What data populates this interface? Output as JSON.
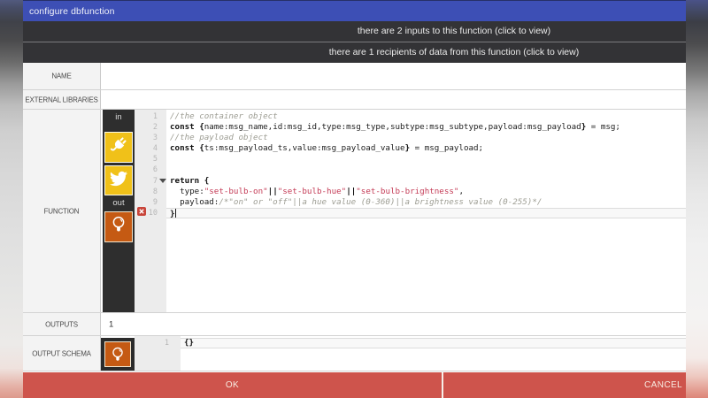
{
  "dialog": {
    "title": "configure dbfunction"
  },
  "info_bars": [
    {
      "label": "there are 2 inputs to this function (click to view)"
    },
    {
      "label": "there are 1 recipients of data from this function (click to view)"
    }
  ],
  "rows": {
    "name": {
      "label": "NAME",
      "value": ""
    },
    "external_libraries": {
      "label": "EXTERNAL LIBRARIES",
      "value": ""
    },
    "function": {
      "label": "FUNCTION"
    },
    "outputs": {
      "label": "OUTPUTS",
      "value": "1"
    },
    "output_schema": {
      "label": "OUTPUT SCHEMA"
    }
  },
  "function_editor": {
    "in_label": "in",
    "out_label": "out",
    "icons": [
      "plug-icon",
      "twitter-icon",
      "bulb-icon"
    ],
    "lines": [
      {
        "num": 1,
        "seg": [
          [
            "cm",
            "//the container object"
          ]
        ]
      },
      {
        "num": 2,
        "seg": [
          [
            "kw",
            "const"
          ],
          [
            "pl",
            " "
          ],
          [
            "br",
            "{"
          ],
          [
            "pl",
            "name:msg_name,id:msg_id,type:msg_type,subtype:msg_subtype,payload:msg_payload"
          ],
          [
            "br",
            "}"
          ],
          [
            "pl",
            " = msg;"
          ]
        ]
      },
      {
        "num": 3,
        "seg": [
          [
            "cm",
            "//the payload object"
          ]
        ]
      },
      {
        "num": 4,
        "seg": [
          [
            "kw",
            "const"
          ],
          [
            "pl",
            " "
          ],
          [
            "br",
            "{"
          ],
          [
            "pl",
            "ts:msg_payload_ts,value:msg_payload_value"
          ],
          [
            "br",
            "}"
          ],
          [
            "pl",
            " = msg_payload;"
          ]
        ]
      },
      {
        "num": 5,
        "seg": []
      },
      {
        "num": 6,
        "seg": []
      },
      {
        "num": 7,
        "fold": true,
        "seg": [
          [
            "kw",
            "return"
          ],
          [
            "pl",
            " "
          ],
          [
            "br",
            "{"
          ]
        ]
      },
      {
        "num": 8,
        "seg": [
          [
            "pl",
            "  type:"
          ],
          [
            "st",
            "\"set-bulb-on\""
          ],
          [
            "op",
            "||"
          ],
          [
            "st",
            "\"set-bulb-hue\""
          ],
          [
            "op",
            "||"
          ],
          [
            "st",
            "\"set-bulb-brightness\""
          ],
          [
            "pl",
            ","
          ]
        ]
      },
      {
        "num": 9,
        "seg": [
          [
            "pl",
            "  payload:"
          ],
          [
            "cm",
            "/*\"on\" or \"off\"||a hue value (0-360)||a brightness value (0-255)*/"
          ]
        ]
      },
      {
        "num": 10,
        "error": true,
        "active": true,
        "caret": true,
        "seg": [
          [
            "br",
            "}"
          ]
        ]
      }
    ]
  },
  "schema_editor": {
    "lines": [
      {
        "num": 1,
        "active": true,
        "seg": [
          [
            "br",
            "{}"
          ]
        ]
      }
    ]
  },
  "footer": {
    "ok_label": "OK",
    "cancel_label": "CANCEL"
  },
  "colors": {
    "titlebar": "#3d4fb5",
    "infobar": "#333336",
    "footer": "#ce544c",
    "node_yellow": "#f0c119",
    "node_orange": "#c55a13",
    "string_token": "#c43b56",
    "comment_token": "#9d9d93"
  }
}
